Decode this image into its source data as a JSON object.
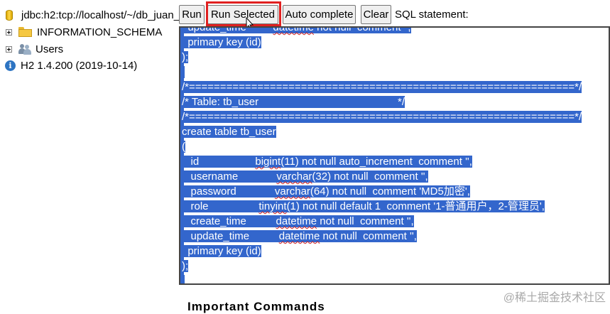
{
  "tree": {
    "connection": "jdbc:h2:tcp://localhost/~/db_juan_",
    "items": [
      {
        "label": "INFORMATION_SCHEMA"
      },
      {
        "label": "Users"
      }
    ],
    "version": "H2 1.4.200 (2019-10-14)"
  },
  "toolbar": {
    "run_label": "Run",
    "run_selected_label": "Run Selected",
    "auto_complete_label": "Auto complete",
    "clear_label": "Clear",
    "sql_statement_label": "SQL statement:"
  },
  "editor": {
    "lines": [
      "  update_time         datetime not null  comment '',",
      "  primary key (id)",
      ");",
      "",
      "/*==============================================================*/",
      "/* Table: tb_user                                               */",
      "/*==============================================================*/",
      "create table tb_user",
      "(",
      "   id                   bigint(11) not null auto_increment  comment '',",
      "   username             varchar(32) not null  comment '',",
      "   password             varchar(64) not null  comment 'MD5加密',",
      "   role                 tinyint(1) not null default 1  comment '1-普通用户，2-管理员',",
      "   create_time          datetime not null  comment '',",
      "   update_time          datetime not null  comment '',",
      "  primary key (id)",
      ");",
      ""
    ]
  },
  "below_text": "Important Commands",
  "watermark": "@稀土掘金技术社区"
}
